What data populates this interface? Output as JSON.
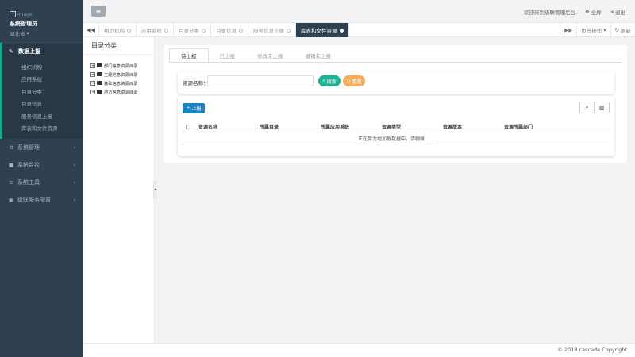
{
  "sidebar": {
    "profile_image_alt": "image",
    "user_name": "系统管理员",
    "user_dept": "湖北省",
    "active_section": {
      "label": "数据上报",
      "icon": "edit-icon",
      "items": [
        "组织机构",
        "应用系统",
        "目录分类",
        "目录信息",
        "服务信息上报",
        "库表和文件资源"
      ]
    },
    "items": [
      {
        "label": "系统管理",
        "icon": "gear-icon"
      },
      {
        "label": "系统监控",
        "icon": "video-icon"
      },
      {
        "label": "系统工具",
        "icon": "list-icon"
      },
      {
        "label": "级联服务配置",
        "icon": "book-icon"
      }
    ]
  },
  "topbar": {
    "welcome": "欢迎来到级联管理后台.",
    "fullscreen": "全屏",
    "logout": "退出"
  },
  "tabs": {
    "items": [
      "组织机构",
      "应用系统",
      "目录分类",
      "目录信息",
      "服务信息上报",
      "库表和文件资源"
    ],
    "active_index": 5,
    "page_ops": "页签操作",
    "refresh": "刷新"
  },
  "tree": {
    "title": "目录分类",
    "nodes": [
      "部门信息资源目录",
      "主题信息资源目录",
      "基础信息资源目录",
      "地方信息资源目录"
    ]
  },
  "main": {
    "subtabs": [
      "待上报",
      "已上报",
      "修改未上报",
      "撤销未上报"
    ],
    "active_subtab": 0,
    "search_label": "资源名称：",
    "search_value": "",
    "search_btn": "搜索",
    "reset_btn": "重置",
    "report_btn": "上报",
    "columns": [
      "资源名称",
      "所属目录",
      "所属应用系统",
      "资源类型",
      "资源版本",
      "资源所属部门"
    ],
    "loading_msg": "正在努力地加载数据中，请稍候……"
  },
  "footer": {
    "copyright": "© 2018 cascade Copyright"
  },
  "colors": {
    "sidebar_bg": "#2f4050",
    "accent_green": "#1ab394",
    "accent_orange": "#f8ac59",
    "accent_blue": "#1c84c6"
  }
}
